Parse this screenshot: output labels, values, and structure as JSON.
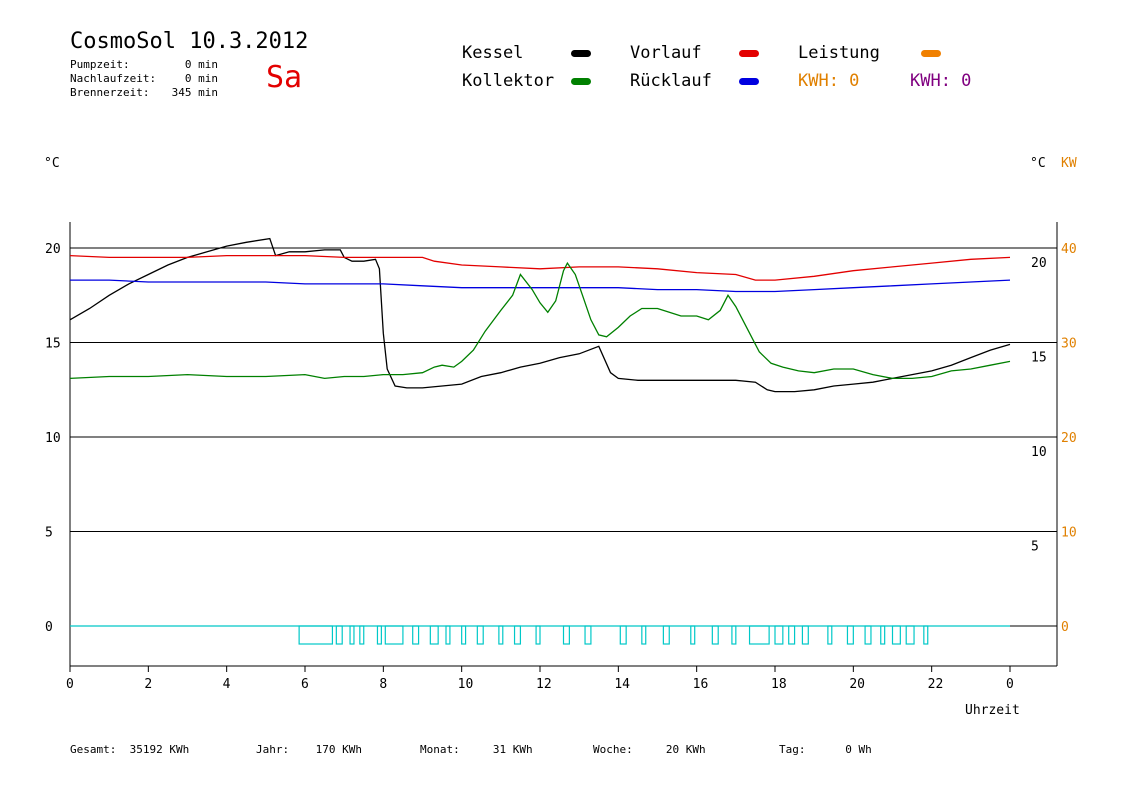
{
  "header": {
    "title": "CosmoSol 10.3.2012",
    "day": "Sa",
    "info": [
      {
        "label": "Pumpzeit:",
        "value": "0 min"
      },
      {
        "label": "Nachlaufzeit:",
        "value": "0 min"
      },
      {
        "label": "Brennerzeit:",
        "value": "345 min"
      }
    ]
  },
  "legend": {
    "kessel": {
      "label": "Kessel",
      "color": "#000000"
    },
    "kollektor": {
      "label": "Kollektor",
      "color": "#008000"
    },
    "vorlauf": {
      "label": "Vorlauf",
      "color": "#e30000"
    },
    "ruecklauf": {
      "label": "Rücklauf",
      "color": "#0000e0"
    },
    "leistung": {
      "label": "Leistung",
      "color": "#f08000"
    },
    "kwh_orange": "KWH: 0",
    "kwh_purple": "KWH: 0",
    "kwh_orange_color": "#e08000",
    "kwh_purple_color": "#800080"
  },
  "stats": [
    {
      "label": "Gesamt:",
      "value": "35192 KWh"
    },
    {
      "label": "Jahr:",
      "value": "170 KWh"
    },
    {
      "label": "Monat:",
      "value": "31 KWh"
    },
    {
      "label": "Woche:",
      "value": "20 KWh"
    },
    {
      "label": "Tag:",
      "value": "0 Wh"
    }
  ],
  "chart_data": {
    "type": "line",
    "xlabel": "Uhrzeit",
    "x_tick_labels": [
      "0",
      "2",
      "4",
      "6",
      "8",
      "10",
      "12",
      "14",
      "16",
      "18",
      "20",
      "22",
      "0"
    ],
    "x_range_hours": [
      0,
      24
    ],
    "y_left_unit": "°C",
    "y_left_ticks": [
      "0",
      "5",
      "10",
      "15",
      "20"
    ],
    "y_left_range": [
      0,
      20
    ],
    "y_right_unit": "°C",
    "y_right_ticks": [
      "5",
      "10",
      "15",
      "20"
    ],
    "y_kw_unit": "KW",
    "y_kw_ticks": [
      "0",
      "10",
      "20",
      "30",
      "40"
    ],
    "y_kw_range": [
      0,
      40
    ],
    "grid": true,
    "series": [
      {
        "name": "Kessel",
        "color": "#000000",
        "points": [
          [
            0,
            16.2
          ],
          [
            0.5,
            16.8
          ],
          [
            1,
            17.5
          ],
          [
            1.5,
            18.1
          ],
          [
            2,
            18.6
          ],
          [
            2.5,
            19.1
          ],
          [
            3,
            19.5
          ],
          [
            3.5,
            19.8
          ],
          [
            4,
            20.1
          ],
          [
            4.5,
            20.3
          ],
          [
            5.1,
            20.5
          ],
          [
            5.25,
            19.6
          ],
          [
            5.6,
            19.8
          ],
          [
            6,
            19.8
          ],
          [
            6.5,
            19.9
          ],
          [
            6.9,
            19.9
          ],
          [
            7.0,
            19.5
          ],
          [
            7.2,
            19.3
          ],
          [
            7.5,
            19.3
          ],
          [
            7.8,
            19.4
          ],
          [
            7.9,
            18.9
          ],
          [
            8.0,
            15.5
          ],
          [
            8.1,
            13.6
          ],
          [
            8.3,
            12.7
          ],
          [
            8.6,
            12.6
          ],
          [
            9,
            12.6
          ],
          [
            9.5,
            12.7
          ],
          [
            10,
            12.8
          ],
          [
            10.5,
            13.2
          ],
          [
            11,
            13.4
          ],
          [
            11.5,
            13.7
          ],
          [
            12,
            13.9
          ],
          [
            12.5,
            14.2
          ],
          [
            13,
            14.4
          ],
          [
            13.5,
            14.8
          ],
          [
            13.8,
            13.4
          ],
          [
            14,
            13.1
          ],
          [
            14.5,
            13.0
          ],
          [
            15,
            13.0
          ],
          [
            15.5,
            13.0
          ],
          [
            16,
            13.0
          ],
          [
            16.5,
            13.0
          ],
          [
            17,
            13.0
          ],
          [
            17.5,
            12.9
          ],
          [
            17.8,
            12.5
          ],
          [
            18,
            12.4
          ],
          [
            18.5,
            12.4
          ],
          [
            19,
            12.5
          ],
          [
            19.5,
            12.7
          ],
          [
            20,
            12.8
          ],
          [
            20.5,
            12.9
          ],
          [
            21,
            13.1
          ],
          [
            21.5,
            13.3
          ],
          [
            22,
            13.5
          ],
          [
            22.5,
            13.8
          ],
          [
            23,
            14.2
          ],
          [
            23.5,
            14.6
          ],
          [
            24,
            14.9
          ]
        ]
      },
      {
        "name": "Vorlauf",
        "color": "#e30000",
        "points": [
          [
            0,
            19.6
          ],
          [
            1,
            19.5
          ],
          [
            2,
            19.5
          ],
          [
            3,
            19.5
          ],
          [
            4,
            19.6
          ],
          [
            5,
            19.6
          ],
          [
            6,
            19.6
          ],
          [
            7,
            19.5
          ],
          [
            8,
            19.5
          ],
          [
            9,
            19.5
          ],
          [
            9.3,
            19.3
          ],
          [
            10,
            19.1
          ],
          [
            11,
            19.0
          ],
          [
            12,
            18.9
          ],
          [
            13,
            19.0
          ],
          [
            14,
            19.0
          ],
          [
            15,
            18.9
          ],
          [
            16,
            18.7
          ],
          [
            17,
            18.6
          ],
          [
            17.5,
            18.3
          ],
          [
            18,
            18.3
          ],
          [
            19,
            18.5
          ],
          [
            20,
            18.8
          ],
          [
            21,
            19.0
          ],
          [
            22,
            19.2
          ],
          [
            23,
            19.4
          ],
          [
            24,
            19.5
          ]
        ]
      },
      {
        "name": "Rücklauf",
        "color": "#0000e0",
        "points": [
          [
            0,
            18.3
          ],
          [
            1,
            18.3
          ],
          [
            2,
            18.2
          ],
          [
            3,
            18.2
          ],
          [
            4,
            18.2
          ],
          [
            5,
            18.2
          ],
          [
            6,
            18.1
          ],
          [
            7,
            18.1
          ],
          [
            8,
            18.1
          ],
          [
            9,
            18.0
          ],
          [
            10,
            17.9
          ],
          [
            11,
            17.9
          ],
          [
            12,
            17.9
          ],
          [
            13,
            17.9
          ],
          [
            14,
            17.9
          ],
          [
            15,
            17.8
          ],
          [
            16,
            17.8
          ],
          [
            17,
            17.7
          ],
          [
            18,
            17.7
          ],
          [
            19,
            17.8
          ],
          [
            20,
            17.9
          ],
          [
            21,
            18.0
          ],
          [
            22,
            18.1
          ],
          [
            23,
            18.2
          ],
          [
            24,
            18.3
          ]
        ]
      },
      {
        "name": "Kollektor",
        "color": "#008000",
        "points": [
          [
            0,
            13.1
          ],
          [
            1,
            13.2
          ],
          [
            2,
            13.2
          ],
          [
            3,
            13.3
          ],
          [
            4,
            13.2
          ],
          [
            5,
            13.2
          ],
          [
            6,
            13.3
          ],
          [
            6.5,
            13.1
          ],
          [
            7,
            13.2
          ],
          [
            7.5,
            13.2
          ],
          [
            8,
            13.3
          ],
          [
            8.5,
            13.3
          ],
          [
            9,
            13.4
          ],
          [
            9.3,
            13.7
          ],
          [
            9.5,
            13.8
          ],
          [
            9.8,
            13.7
          ],
          [
            10,
            14.0
          ],
          [
            10.3,
            14.6
          ],
          [
            10.6,
            15.6
          ],
          [
            11,
            16.7
          ],
          [
            11.3,
            17.5
          ],
          [
            11.5,
            18.6
          ],
          [
            11.8,
            17.8
          ],
          [
            12,
            17.1
          ],
          [
            12.2,
            16.6
          ],
          [
            12.4,
            17.2
          ],
          [
            12.6,
            18.8
          ],
          [
            12.7,
            19.2
          ],
          [
            12.9,
            18.6
          ],
          [
            13.1,
            17.4
          ],
          [
            13.3,
            16.2
          ],
          [
            13.5,
            15.4
          ],
          [
            13.7,
            15.3
          ],
          [
            14,
            15.8
          ],
          [
            14.3,
            16.4
          ],
          [
            14.6,
            16.8
          ],
          [
            15,
            16.8
          ],
          [
            15.3,
            16.6
          ],
          [
            15.6,
            16.4
          ],
          [
            16,
            16.4
          ],
          [
            16.3,
            16.2
          ],
          [
            16.6,
            16.7
          ],
          [
            16.8,
            17.5
          ],
          [
            17,
            16.9
          ],
          [
            17.3,
            15.7
          ],
          [
            17.6,
            14.5
          ],
          [
            17.9,
            13.9
          ],
          [
            18.2,
            13.7
          ],
          [
            18.6,
            13.5
          ],
          [
            19,
            13.4
          ],
          [
            19.5,
            13.6
          ],
          [
            20,
            13.6
          ],
          [
            20.5,
            13.3
          ],
          [
            21,
            13.1
          ],
          [
            21.5,
            13.1
          ],
          [
            22,
            13.2
          ],
          [
            22.5,
            13.5
          ],
          [
            23,
            13.6
          ],
          [
            23.5,
            13.8
          ],
          [
            24,
            14.0
          ]
        ]
      }
    ],
    "pump_signal": {
      "color": "#00c8c8",
      "pulses": [
        [
          5.85,
          6.7
        ],
        [
          6.8,
          6.95
        ],
        [
          7.15,
          7.25
        ],
        [
          7.4,
          7.5
        ],
        [
          7.85,
          7.95
        ],
        [
          8.05,
          8.5
        ],
        [
          8.75,
          8.9
        ],
        [
          9.2,
          9.4
        ],
        [
          9.6,
          9.7
        ],
        [
          10,
          10.1
        ],
        [
          10.4,
          10.55
        ],
        [
          10.95,
          11.05
        ],
        [
          11.35,
          11.5
        ],
        [
          11.9,
          12.0
        ],
        [
          12.6,
          12.75
        ],
        [
          13.15,
          13.3
        ],
        [
          14.05,
          14.2
        ],
        [
          14.6,
          14.7
        ],
        [
          15.15,
          15.3
        ],
        [
          15.85,
          15.95
        ],
        [
          16.4,
          16.55
        ],
        [
          16.9,
          17.0
        ],
        [
          17.35,
          17.85
        ],
        [
          18.0,
          18.2
        ],
        [
          18.35,
          18.5
        ],
        [
          18.7,
          18.85
        ],
        [
          19.35,
          19.45
        ],
        [
          19.85,
          20.0
        ],
        [
          20.3,
          20.45
        ],
        [
          20.7,
          20.8
        ],
        [
          21.0,
          21.2
        ],
        [
          21.35,
          21.55
        ],
        [
          21.8,
          21.9
        ]
      ]
    }
  }
}
